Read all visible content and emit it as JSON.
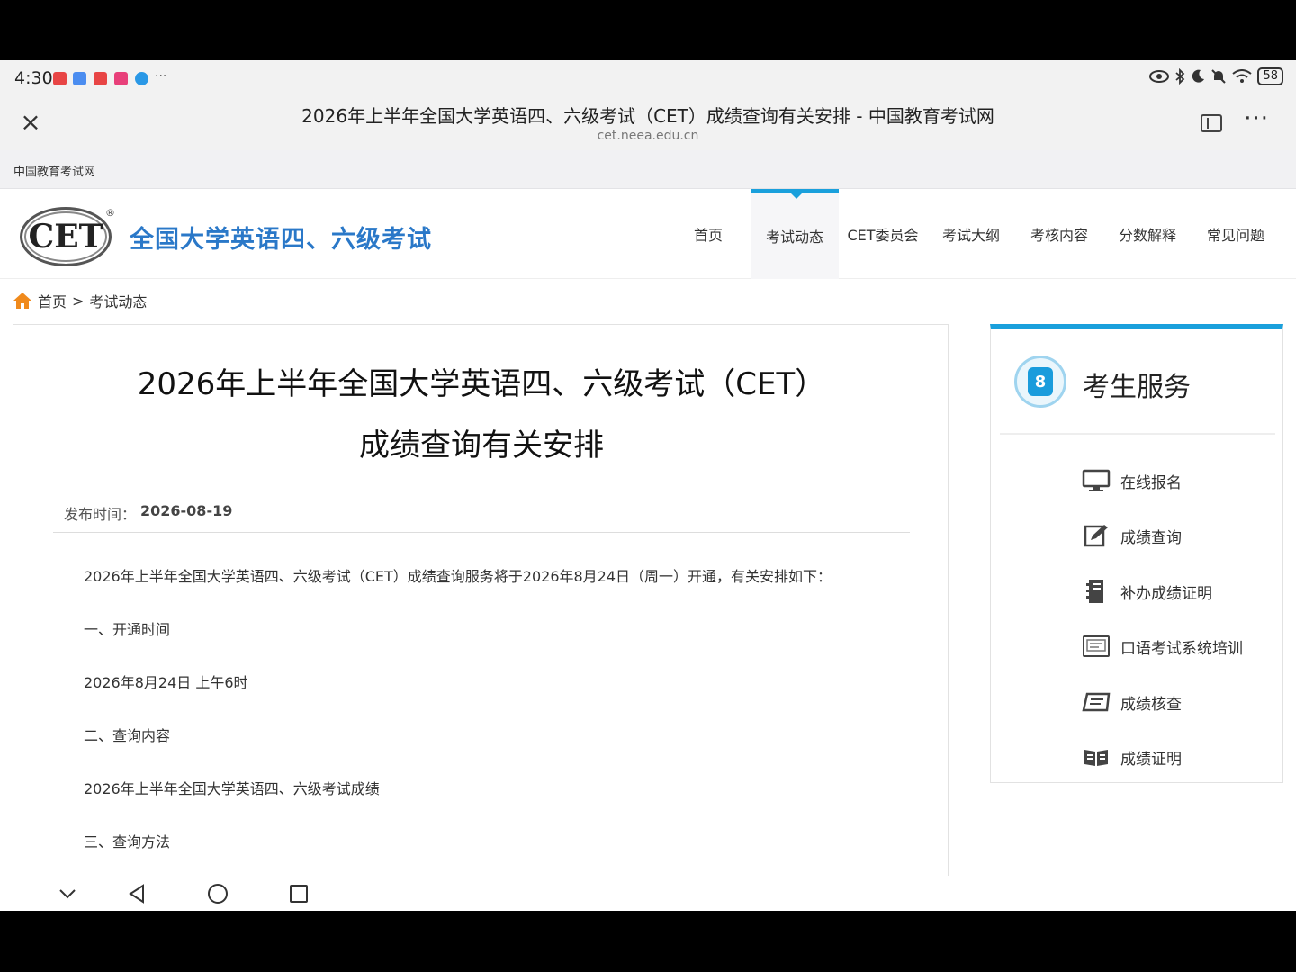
{
  "status_bar": {
    "time": "4:30",
    "notification_dots": "···",
    "battery": "58",
    "notification_colors": [
      "#e84545",
      "#4b8df0",
      "#e84545",
      "#e8407a",
      "#2a98e6"
    ]
  },
  "browser": {
    "close_symbol": "×",
    "title": "2026年上半年全国大学英语四、六级考试（CET）成绩查询有关安排 - 中国教育考试网",
    "url": "cet.neea.edu.cn",
    "more_symbol": "···"
  },
  "top_strip": {
    "text": "中国教育考试网"
  },
  "site": {
    "logo_text": "CET",
    "logo_reg": "®",
    "title": "全国大学英语四、六级考试",
    "nav": [
      "首页",
      "考试动态",
      "CET委员会",
      "考试大纲",
      "考核内容",
      "分数解释",
      "常见问题"
    ],
    "nav_active_index": 1,
    "accent_color": "#1aa0dc",
    "title_color": "#2a78c8"
  },
  "breadcrumb": {
    "home": "首页",
    "separator": ">",
    "current": "考试动态"
  },
  "article": {
    "title_line1": "2026年上半年全国大学英语四、六级考试（CET）",
    "title_line2": "成绩查询有关安排",
    "publish_label": "发布时间：",
    "publish_date": "2026-08-19",
    "paragraphs": [
      "2026年上半年全国大学英语四、六级考试（CET）成绩查询服务将于2026年8月24日（周一）开通，有关安排如下：",
      "一、开通时间",
      "2026年8月24日 上午6时",
      "二、查询内容",
      "2026年上半年全国大学英语四、六级考试成绩",
      "三、查询方法"
    ]
  },
  "service": {
    "title": "考生服务",
    "items": [
      {
        "label": "在线报名",
        "icon": "monitor-icon"
      },
      {
        "label": "成绩查询",
        "icon": "edit-icon"
      },
      {
        "label": "补办成绩证明",
        "icon": "binder-icon"
      },
      {
        "label": "口语考试系统培训",
        "icon": "screen-icon"
      },
      {
        "label": "成绩核查",
        "icon": "document-icon"
      },
      {
        "label": "成绩证明",
        "icon": "book-icon"
      }
    ]
  }
}
